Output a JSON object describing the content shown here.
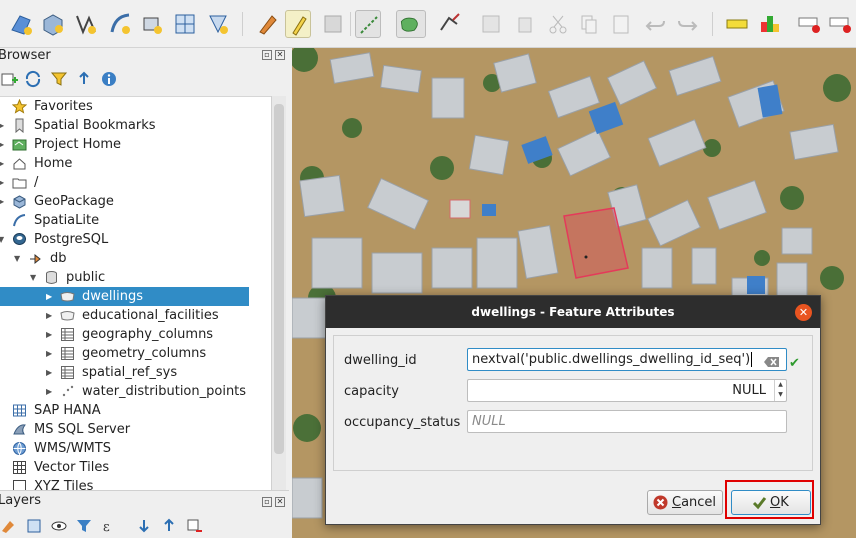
{
  "colors": {
    "accent": "#308cc6",
    "highlight_box": "#e00000",
    "dialog_close": "#e95420",
    "dialog_titlebar": "#2d2d2d",
    "selected_polygon": "#e43a5a"
  },
  "toolbar": {
    "icons": [
      "open-data-source-manager-icon",
      "new-geopackage-layer-icon",
      "digitize-vertex-icon",
      "digitize-curve-icon",
      "select-by-location-icon",
      "grid-layer-icon",
      "shape-digitize-icon",
      "current-edits-icon",
      "toggle-editing-icon",
      "save-edits-icon",
      "add-line-feature-icon",
      "add-polygon-feature-icon",
      "vertex-tool-icon",
      "modify-attributes-icon",
      "delete-selected-icon",
      "cut-features-icon",
      "copy-features-icon",
      "paste-features-icon",
      "undo-icon",
      "redo-icon",
      "label-tool-icon",
      "layer-diagram-icon",
      "label-pin-icon",
      "label-remove-icon"
    ]
  },
  "browser": {
    "title": "Browser",
    "items": [
      {
        "label": "Favorites",
        "icon": "star-icon"
      },
      {
        "label": "Spatial Bookmarks",
        "icon": "bookmark-icon"
      },
      {
        "label": "Project Home",
        "icon": "project-home-icon"
      },
      {
        "label": "Home",
        "icon": "home-icon"
      },
      {
        "label": "/",
        "icon": "folder-icon"
      },
      {
        "label": "GeoPackage",
        "icon": "geopackage-icon"
      },
      {
        "label": "SpatiaLite",
        "icon": "spatialite-icon"
      },
      {
        "label": "PostgreSQL",
        "icon": "postgresql-icon"
      },
      {
        "label": "db",
        "icon": "db-connection-icon"
      },
      {
        "label": "public",
        "icon": "schema-icon"
      },
      {
        "label": "dwellings",
        "icon": "polygon-layer-icon"
      },
      {
        "label": "educational_facilities",
        "icon": "polygon-layer-icon"
      },
      {
        "label": "geography_columns",
        "icon": "table-icon"
      },
      {
        "label": "geometry_columns",
        "icon": "table-icon"
      },
      {
        "label": "spatial_ref_sys",
        "icon": "table-icon"
      },
      {
        "label": "water_distribution_points",
        "icon": "point-layer-icon"
      },
      {
        "label": "SAP HANA",
        "icon": "sap-hana-icon"
      },
      {
        "label": "MS SQL Server",
        "icon": "mssql-icon"
      },
      {
        "label": "WMS/WMTS",
        "icon": "wms-icon"
      },
      {
        "label": "Vector Tiles",
        "icon": "vector-tiles-icon"
      },
      {
        "label": "XYZ Tiles",
        "icon": "xyz-tiles-icon"
      }
    ]
  },
  "layers": {
    "title": "Layers"
  },
  "dialog": {
    "title": "dwellings - Feature Attributes",
    "fields": [
      {
        "label": "dwelling_id",
        "value": "nextval('public.dwellings_dwelling_id_seq')"
      },
      {
        "label": "capacity",
        "value": "NULL"
      },
      {
        "label": "occupancy_status",
        "value": "NULL"
      }
    ],
    "cancel_label": "Cancel",
    "ok_label": "OK",
    "cancel_mnemonic": "C",
    "ok_mnemonic": "O"
  }
}
